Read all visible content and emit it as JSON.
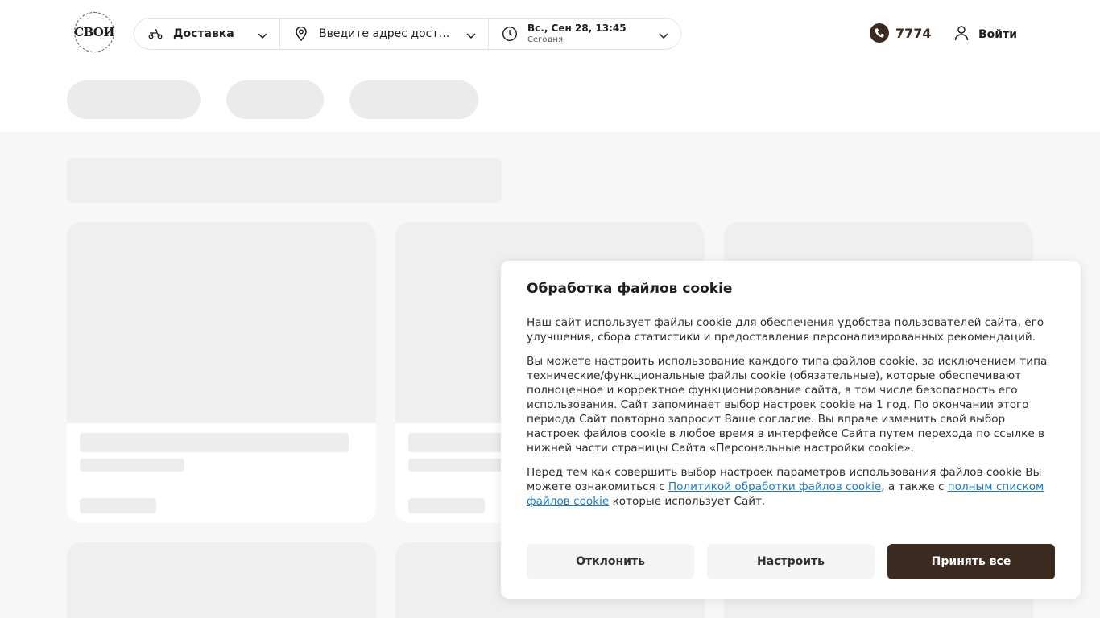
{
  "header": {
    "logo_text": "СВОИ",
    "delivery": {
      "label": "Доставка",
      "icon": "scooter-icon"
    },
    "address": {
      "label": "Введите адрес доставки",
      "icon": "location-pin-icon"
    },
    "time": {
      "main": "Вс., Сен 28, 13:45",
      "sub": "Сегодня",
      "icon": "clock-icon"
    },
    "phone": {
      "number": "7774",
      "icon": "phone-icon"
    },
    "login": {
      "label": "Войти",
      "icon": "user-icon"
    }
  },
  "cookie": {
    "title": "Обработка файлов cookie",
    "p1": "Наш сайт использует файлы cookie для обеспечения удобства пользователей сайта, его улучшения, сбора статистики и предоставления персонализированных рекомендаций.",
    "p2": "Вы можете настроить использование каждого типа файлов cookie, за исключением типа технические/функциональные файлы cookie (обязательные), которые обеспечивают полноценное и корректное функционирование сайта, в том числе безопасность его использования. Сайт запоминает выбор настроек cookie на 1 год. По окончании этого периода Сайт повторно запросит Ваше согласие. Вы вправе изменить свой выбор настроек файлов cookie в любое время в интерфейсе Сайта путем перехода по ссылке в нижней части страницы Сайта «Персональные настройки cookie».",
    "p3_start": "Перед тем как совершить выбор настроек параметров использования файлов cookie Вы можете ознакомиться с ",
    "p3_link1": "Политикой обработки файлов cookie",
    "p3_mid": ", а также с ",
    "p3_link2": "полным списком файлов cookie",
    "p3_end": " которые использует Сайт.",
    "buttons": {
      "decline": "Отклонить",
      "configure": "Настроить",
      "accept": "Принять все"
    }
  },
  "colors": {
    "brand": "#3a2a1f",
    "link": "#1a7bc8",
    "skeleton": "#ebebeb"
  }
}
